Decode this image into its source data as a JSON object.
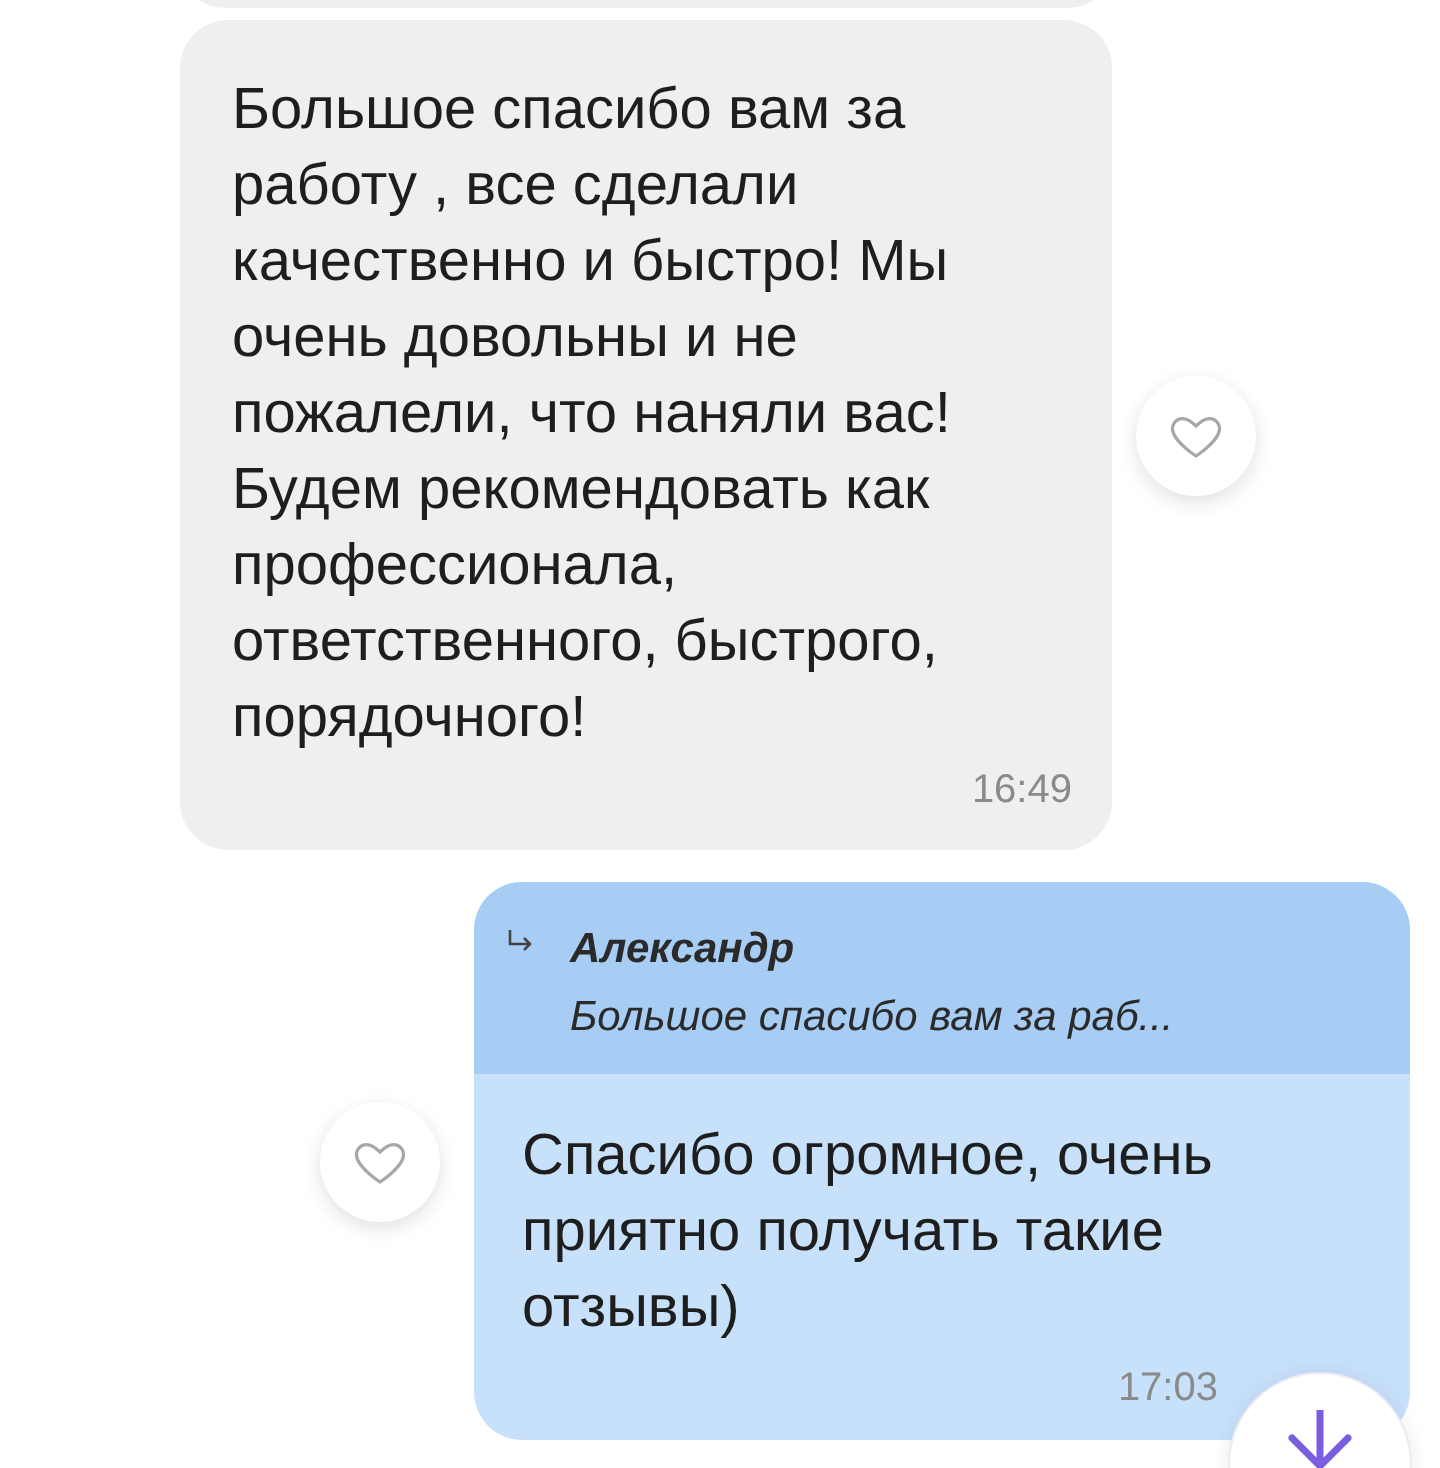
{
  "messages": [
    {
      "kind": "incoming",
      "text": "Большое спасибо вам за работу , все сделали качественно и быстро! Мы очень довольны и не пожалели, что наняли вас! Будем рекомендовать как профессионала, ответственного, быстрого, порядочного!",
      "time": "16:49",
      "liked": false
    },
    {
      "kind": "outgoing",
      "reply": {
        "author": "Александр",
        "quote": "Большое спасибо вам за раб..."
      },
      "text": "Спасибо огромное, очень приятно получать такие отзывы)",
      "time": "17:03",
      "liked": false
    }
  ]
}
